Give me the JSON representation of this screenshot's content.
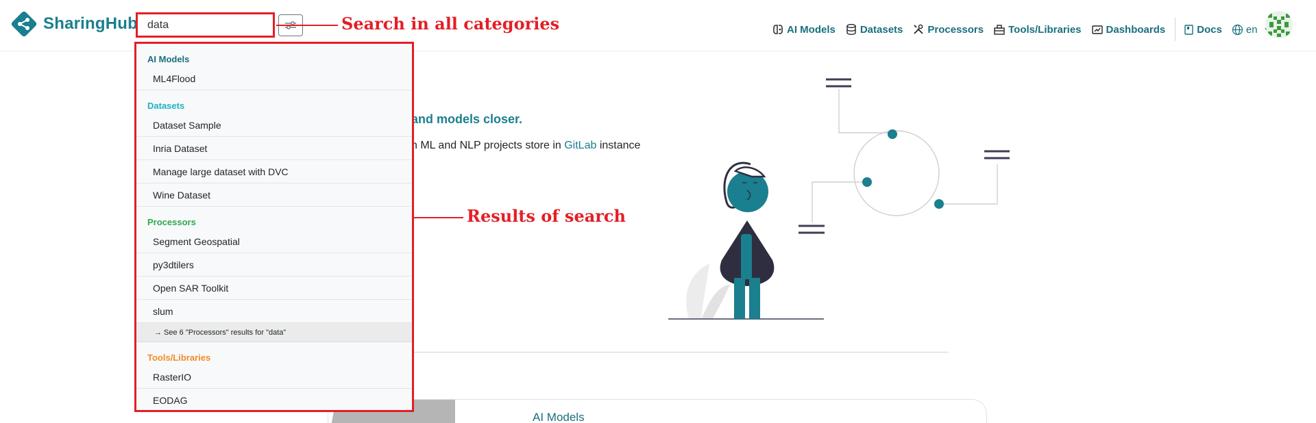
{
  "app": {
    "name": "SharingHub"
  },
  "search": {
    "value": "data",
    "placeholder": ""
  },
  "annotations": {
    "search_label": "Search in all categories",
    "results_label": "Results of search"
  },
  "nav": {
    "items": [
      {
        "label": "AI Models",
        "icon": "ai-models-icon"
      },
      {
        "label": "Datasets",
        "icon": "database-icon"
      },
      {
        "label": "Processors",
        "icon": "tools-icon"
      },
      {
        "label": "Tools/Libraries",
        "icon": "toolbox-icon"
      },
      {
        "label": "Dashboards",
        "icon": "dashboard-icon"
      }
    ],
    "docs": "Docs",
    "language": "en"
  },
  "hero": {
    "tagline": "and models closer.",
    "description_prefix": "n ML and NLP projects store in ",
    "description_link": "GitLab",
    "description_suffix": " instance"
  },
  "bottom_card": {
    "title": "AI Models"
  },
  "dropdown": {
    "groups": [
      {
        "title": "AI Models",
        "color": "#1a6f7e",
        "items": [
          "ML4Flood"
        ]
      },
      {
        "title": "Datasets",
        "color": "#1bb3c8",
        "items": [
          "Dataset Sample",
          "Inria Dataset",
          "Manage large dataset with DVC",
          "Wine Dataset"
        ]
      },
      {
        "title": "Processors",
        "color": "#2fa84f",
        "items": [
          "Segment Geospatial",
          "py3dtilers",
          "Open SAR Toolkit",
          "slum"
        ],
        "more": "→ See 6 \"Processors\" results for \"data\""
      },
      {
        "title": "Tools/Libraries",
        "color": "#f28c28",
        "items": [
          "RasterIO",
          "EODAG"
        ]
      }
    ]
  },
  "colors": {
    "accent": "#1a7f8e",
    "annotation": "#e41e26"
  }
}
